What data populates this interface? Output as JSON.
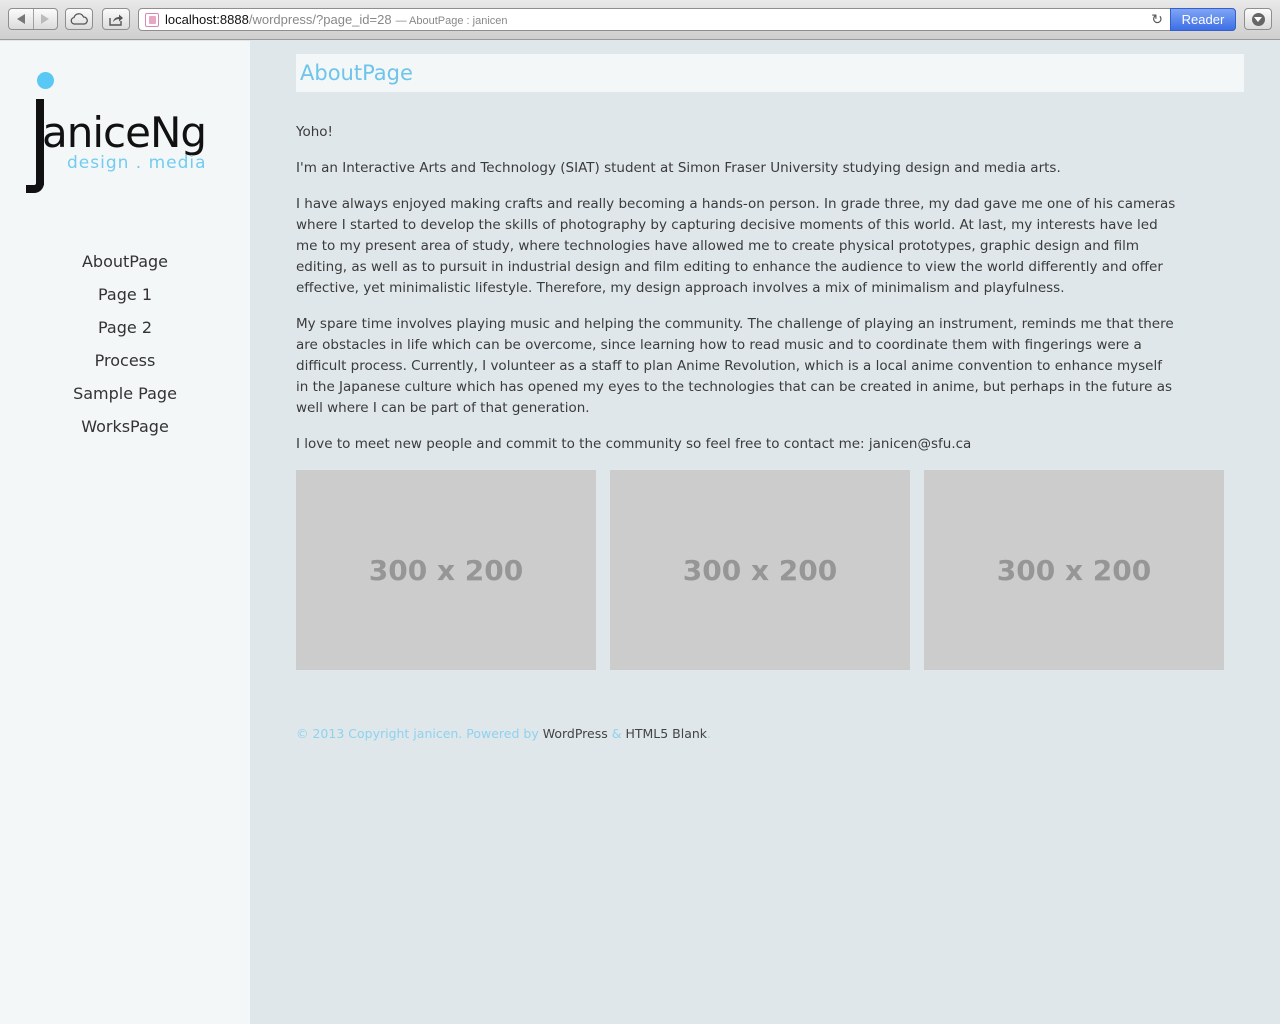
{
  "browser": {
    "url_host": "localhost:8888",
    "url_path": "/wordpress/?page_id=28",
    "url_title": "— AboutPage : janicen",
    "reader_label": "Reader",
    "icons": [
      "back-arrow-icon",
      "forward-arrow-icon",
      "icloud-tabs-icon",
      "share-icon",
      "favicon-icon",
      "reload-icon",
      "download-icon"
    ]
  },
  "site": {
    "logo_name": "aniceNg",
    "logo_tagline": "design . media"
  },
  "menu": [
    "AboutPage",
    "Page 1",
    "Page 2",
    "Process",
    "Sample Page",
    "WorksPage"
  ],
  "page": {
    "title": "AboutPage",
    "paragraphs": [
      "Yoho!",
      "I'm an Interactive Arts and Technology (SIAT) student at Simon Fraser University studying design and media arts.",
      "I have always enjoyed making crafts and really becoming a hands-on person. In grade three, my dad gave me one of his cameras where I started to develop the skills of photography by capturing decisive moments of this world. At last, my interests have led me to my present area of study, where technologies have allowed me to create physical prototypes, graphic design and film editing, as well as to pursuit in industrial design and film editing to enhance the audience to view the world differently and offer effective, yet minimalistic lifestyle. Therefore, my design approach involves a mix of minimalism and playfulness.",
      "My spare time involves playing music and helping the community. The challenge of playing an instrument, reminds me that there are obstacles in life which can be overcome, since learning how to read music and to coordinate them with fingerings were a difficult process. Currently, I volunteer as a staff to plan Anime Revolution, which is a local anime convention to enhance myself in the Japanese culture which has opened my eyes to the technologies that can be created in anime, but perhaps in the future as well where I can be part of that generation.",
      "I love to meet new people and commit to the community so feel free to contact me: janicen@sfu.ca"
    ],
    "thumbnails": [
      "300 x 200",
      "300 x 200",
      "300 x 200"
    ]
  },
  "footer": {
    "copyright": "© 2013 Copyright janicen. Powered by ",
    "wordpress": "WordPress",
    "amp": " & ",
    "html5blank": "HTML5 Blank",
    "end": "."
  },
  "colors": {
    "accent": "#6ec4ea",
    "sidebar_bg": "#f3f7f8",
    "main_bg": "#dfe7ea",
    "placeholder_bg": "#cccccc",
    "reader_blue": "#3d6ee6"
  }
}
